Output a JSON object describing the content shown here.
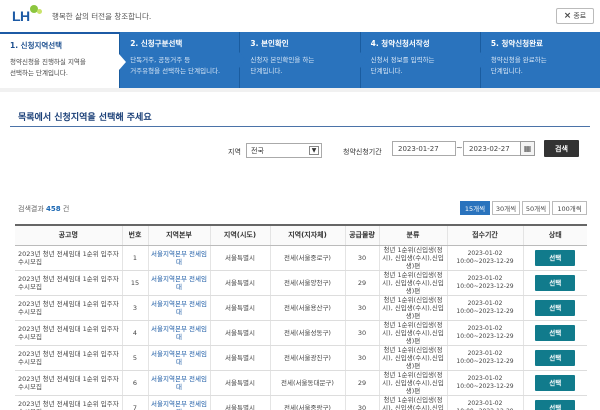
{
  "header": {
    "logo_text": "LH",
    "slogan": "행복한 삶의 터전을 창조합니다.",
    "close_label": "종료"
  },
  "steps": [
    {
      "title": "1. 신청지역선택",
      "desc": [
        "청약신청을 진행하실 지역을",
        "선택하는 단계입니다."
      ]
    },
    {
      "title": "2. 신청구분선택",
      "desc": [
        "단독거주, 공동거주 등",
        "거주유형을 선택하는 단계입니다."
      ]
    },
    {
      "title": "3. 본인확인",
      "desc": [
        "신청자 본인확인을 하는",
        "단계입니다."
      ]
    },
    {
      "title": "4. 청약신청서작성",
      "desc": [
        "신청서 정보를 입력하는",
        "단계입니다."
      ]
    },
    {
      "title": "5. 청약신청완료",
      "desc": [
        "청약신청을 완료하는",
        "단계입니다."
      ]
    }
  ],
  "section_title": "목록에서 신청지역을 선택해 주세요",
  "search": {
    "region_label": "지역",
    "region_value": "전국",
    "period_label": "청약신청기간",
    "start_date": "2023-01-27",
    "end_date": "2023-02-27",
    "button_label": "검색"
  },
  "results": {
    "prefix": "검색결과",
    "count": "458",
    "suffix": "건",
    "per_page": [
      "15개씩",
      "30개씩",
      "50개씩",
      "100개씩"
    ]
  },
  "table": {
    "headers": [
      "공고명",
      "번호",
      "지역본부",
      "지역(시도)",
      "지역(지자체)",
      "공급물량",
      "분류",
      "접수기간",
      "상태"
    ],
    "rows": [
      {
        "name": "2023년 청년 전세임대 1순위 입주자 수시모집",
        "no": "1",
        "office": "서울지역본부 전세임대",
        "city": "서울특별시",
        "district": "전세(서울중로구)",
        "qty": "30",
        "cls": "청년 1순위(신입생(정시), 신입생(수시),신입생)편",
        "period": "2023-01-02 10:00~2023-12-29",
        "status": "선택"
      },
      {
        "name": "2023년 청년 전세임대 1순위 입주자 수시모집",
        "no": "15",
        "office": "서울지역본부 전세임대",
        "city": "서울특별시",
        "district": "전세(서울양천구)",
        "qty": "29",
        "cls": "청년 1순위(신입생(정시), 신입생(수시),신입생)편",
        "period": "2023-01-02 10:00~2023-12-29",
        "status": "선택"
      },
      {
        "name": "2023년 청년 전세임대 1순위 입주자 수시모집",
        "no": "3",
        "office": "서울지역본부 전세임대",
        "city": "서울특별시",
        "district": "전세(서울용산구)",
        "qty": "30",
        "cls": "청년 1순위(신입생(정시), 신입생(수시),신입생)편",
        "period": "2023-01-02 10:00~2023-12-29",
        "status": "선택"
      },
      {
        "name": "2023년 청년 전세임대 1순위 입주자 수시모집",
        "no": "4",
        "office": "서울지역본부 전세임대",
        "city": "서울특별시",
        "district": "전세(서울성동구)",
        "qty": "30",
        "cls": "청년 1순위(신입생(정시), 신입생(수시),신입생)편",
        "period": "2023-01-02 10:00~2023-12-29",
        "status": "선택"
      },
      {
        "name": "2023년 청년 전세임대 1순위 입주자 수시모집",
        "no": "5",
        "office": "서울지역본부 전세임대",
        "city": "서울특별시",
        "district": "전세(서울광진구)",
        "qty": "30",
        "cls": "청년 1순위(신입생(정시), 신입생(수시),신입생)편",
        "period": "2023-01-02 10:00~2023-12-29",
        "status": "선택"
      },
      {
        "name": "2023년 청년 전세임대 1순위 입주자 수시모집",
        "no": "6",
        "office": "서울지역본부 전세임대",
        "city": "서울특별시",
        "district": "전세(서울동대문구)",
        "qty": "29",
        "cls": "청년 1순위(신입생(정시), 신입생(수시),신입생)편",
        "period": "2023-01-02 10:00~2023-12-29",
        "status": "선택"
      },
      {
        "name": "2023년 청년 전세임대 1순위 입주자 수시모집",
        "no": "7",
        "office": "서울지역본부 전세임대",
        "city": "서울특별시",
        "district": "전세(서울중랑구)",
        "qty": "30",
        "cls": "청년 1순위(신입생(정시), 신입생(수시),신입생)편",
        "period": "2023-01-02 10:00~2023-12-29",
        "status": "선택"
      }
    ]
  }
}
